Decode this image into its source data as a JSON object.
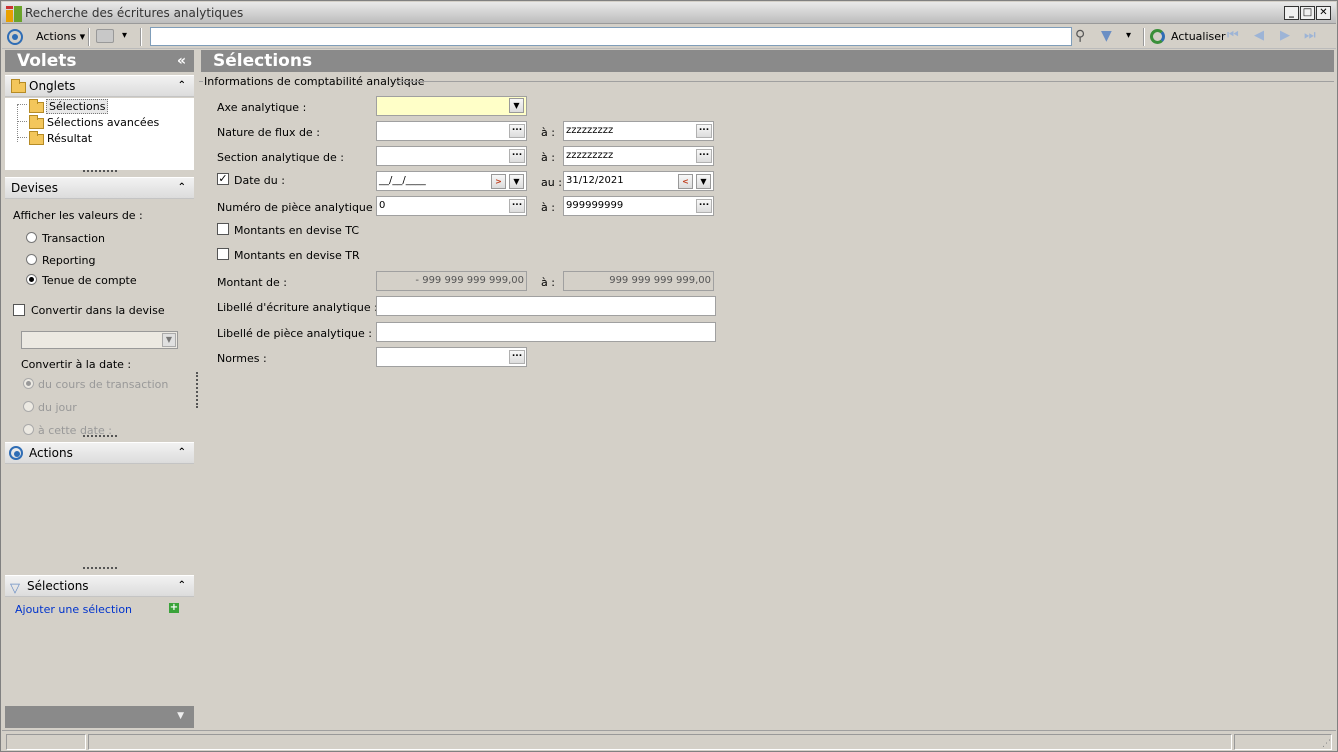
{
  "window": {
    "title": "Recherche des écritures analytiques"
  },
  "toolbar": {
    "actions_label": "Actions",
    "search_value": "",
    "refresh_label": "Actualiser"
  },
  "left_pane": {
    "title": "Volets",
    "collapse_glyph": "«",
    "onglets": {
      "header": "Onglets",
      "items": [
        {
          "label": "Sélections",
          "selected": true
        },
        {
          "label": "Sélections avancées",
          "selected": false
        },
        {
          "label": "Résultat",
          "selected": false
        }
      ]
    },
    "devises": {
      "header": "Devises",
      "show_values_label": "Afficher les valeurs de :",
      "radios": [
        {
          "label": "Transaction",
          "checked": false
        },
        {
          "label": "Reporting",
          "checked": false
        },
        {
          "label": "Tenue de compte",
          "checked": true
        }
      ],
      "convert_label": "Convertir dans la devise",
      "convert_checked": false,
      "currency_value": "",
      "convert_date_label": "Convertir à la date :",
      "date_radios": [
        {
          "label": "du cours de transaction",
          "checked": true
        },
        {
          "label": "du jour",
          "checked": false
        },
        {
          "label": "à cette date :",
          "checked": false
        }
      ]
    },
    "actions": {
      "header": "Actions"
    },
    "selections": {
      "header": "Sélections",
      "add_link": "Ajouter une sélection"
    }
  },
  "main": {
    "title": "Sélections",
    "group_title": "Informations de comptabilité analytique",
    "fields": {
      "axe": {
        "label": "Axe analytique :",
        "value": ""
      },
      "nature": {
        "label": "Nature de flux de :",
        "from": "",
        "to_label": "à :",
        "to": "zzzzzzzzz"
      },
      "section": {
        "label": "Section analytique de :",
        "from": "",
        "to_label": "à :",
        "to": "zzzzzzzzz"
      },
      "date": {
        "label": "Date du :",
        "checked": true,
        "from": "__/__/____",
        "to_label": "au :",
        "to": "31/12/2021"
      },
      "numero": {
        "label": "Numéro de pièce analytique de :",
        "from": "0",
        "to_label": "à :",
        "to": "999999999"
      },
      "montants_tc": {
        "label": "Montants en devise TC",
        "checked": false
      },
      "montants_tr": {
        "label": "Montants en devise TR",
        "checked": false
      },
      "montant": {
        "label": "Montant de :",
        "from": "- 999 999 999 999,00",
        "to_label": "à :",
        "to": "999 999 999 999,00"
      },
      "libelle_ecriture": {
        "label": "Libellé d'écriture analytique :",
        "value": ""
      },
      "libelle_piece": {
        "label": "Libellé de pièce analytique :",
        "value": ""
      },
      "normes": {
        "label": "Normes :",
        "value": ""
      }
    }
  },
  "colors": {
    "header_gray": "#8a8a8a",
    "window_bg": "#d4d0c8",
    "yellow_field": "#ffffc8",
    "link_blue": "#0033cc"
  }
}
